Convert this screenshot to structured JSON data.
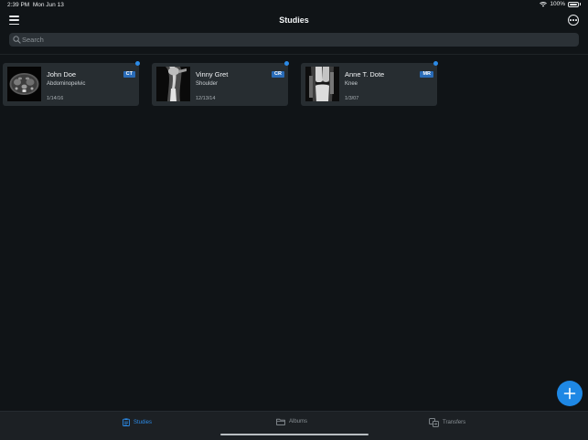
{
  "status_bar": {
    "time": "2:39 PM",
    "date": "Mon Jun 13",
    "battery": "100%"
  },
  "nav": {
    "title": "Studies",
    "menu_icon": "hamburger-menu-icon",
    "more_icon": "ellipsis-circle-icon"
  },
  "search": {
    "placeholder": "Search",
    "value": ""
  },
  "studies": [
    {
      "name": "John Doe",
      "region": "Abdominopelvic",
      "date": "1/14/16",
      "modality": "CT",
      "unread": true
    },
    {
      "name": "Vinny Gret",
      "region": "Shoulder",
      "date": "12/13/14",
      "modality": "CR",
      "unread": true
    },
    {
      "name": "Anne T. Dote",
      "region": "Knee",
      "date": "1/3/07",
      "modality": "MR",
      "unread": true
    }
  ],
  "fab": {
    "icon": "plus-icon"
  },
  "tabs": [
    {
      "label": "Studies",
      "icon": "clipboard-icon",
      "active": true
    },
    {
      "label": "Albums",
      "icon": "folder-icon",
      "active": false
    },
    {
      "label": "Transfers",
      "icon": "transfer-icon",
      "active": false
    }
  ],
  "colors": {
    "background": "#101417",
    "card": "#272d31",
    "accent": "#2c8ae6",
    "badge": "#2a6cb8"
  }
}
